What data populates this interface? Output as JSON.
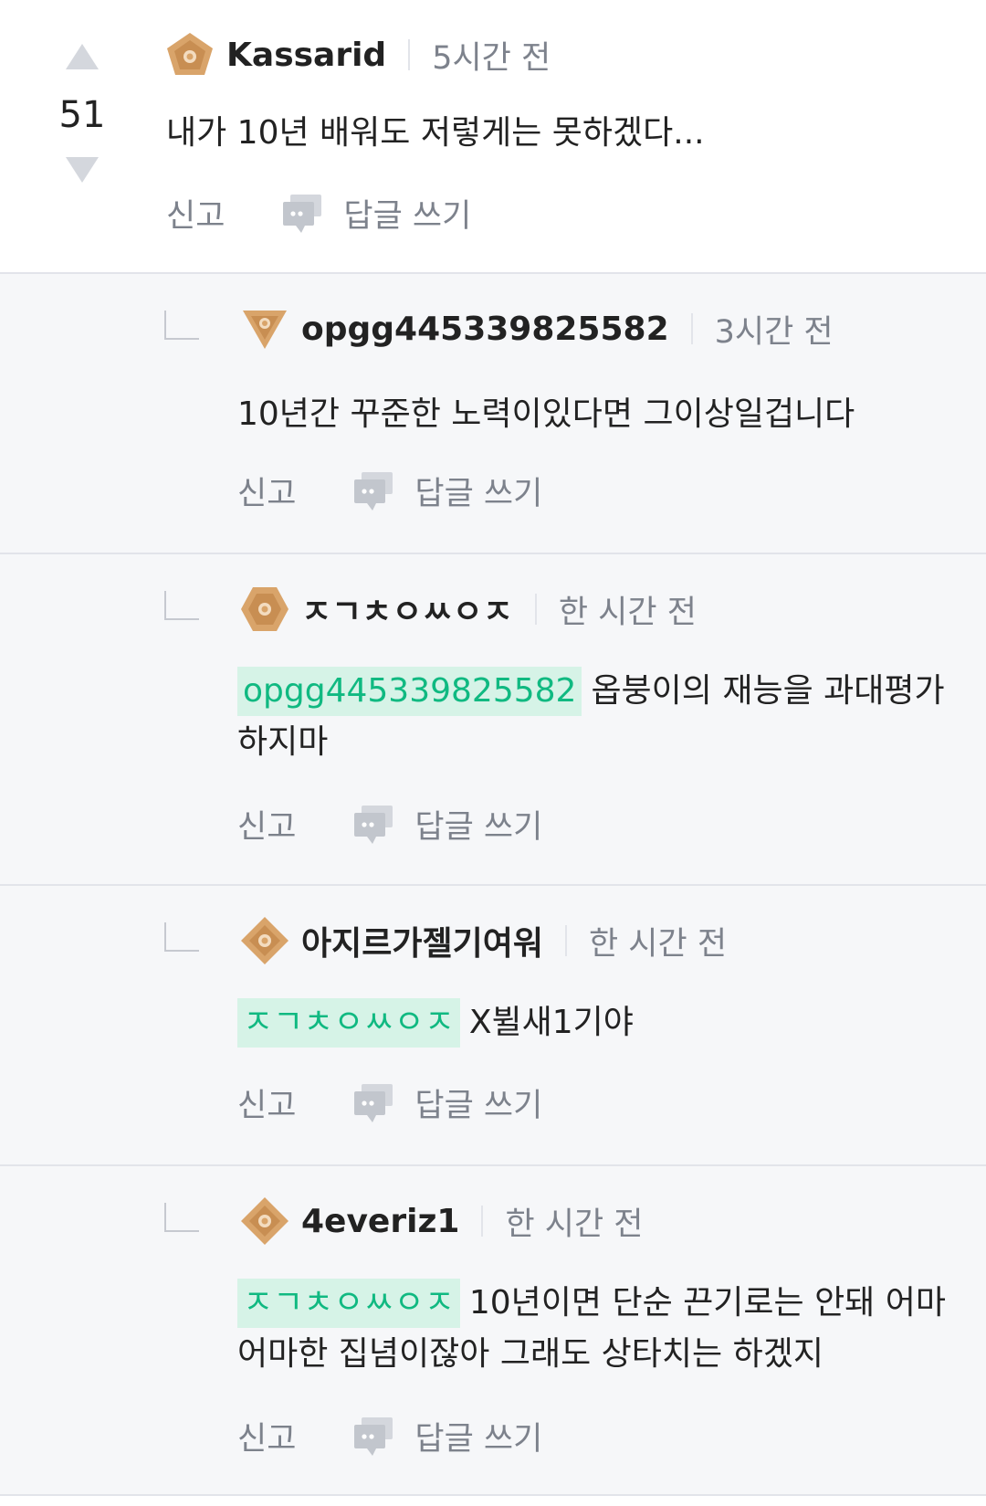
{
  "comments": [
    {
      "username": "Kassarid",
      "time": "5시간 전",
      "vote_count": "51",
      "text": "내가 10년 배워도 저렇게는 못하겠다...",
      "badge": "pentagon-rank-icon",
      "report_label": "신고",
      "reply_label": "답글 쓰기"
    },
    {
      "username": "opgg445339825582",
      "time": "3시간 전",
      "text": "10년간 꾸준한 노력이있다면 그이상일겁니다",
      "badge": "triangle-rank-icon",
      "report_label": "신고",
      "reply_label": "답글 쓰기"
    },
    {
      "username": "ㅈㄱㅊㅇㅆㅇㅈ",
      "time": "한 시간 전",
      "mention": "opgg445339825582",
      "text": "옵붕이의 재능을 과대평가 하지마",
      "badge": "hexagon-rank-icon",
      "report_label": "신고",
      "reply_label": "답글 쓰기"
    },
    {
      "username": "아지르가젤기여워",
      "time": "한 시간 전",
      "mention": "ㅈㄱㅊㅇㅆㅇㅈ",
      "text": "X뷜새1기야",
      "badge": "diamond-rank-icon",
      "report_label": "신고",
      "reply_label": "답글 쓰기"
    },
    {
      "username": "4everiz1",
      "time": "한 시간 전",
      "mention": "ㅈㄱㅊㅇㅆㅇㅈ",
      "text": "10년이면 단순 끈기로는 안돼 어마어마한 집념이잖아 그래도 상타치는 하겠지",
      "badge": "diamond-rank-icon",
      "report_label": "신고",
      "reply_label": "답글 쓰기"
    }
  ],
  "colors": {
    "mention_bg": "#d6f3e7",
    "mention_text": "#10b981",
    "muted": "#7d828c",
    "reply_bg": "#f6f7f9",
    "badge_gold": "#d9a46a"
  }
}
